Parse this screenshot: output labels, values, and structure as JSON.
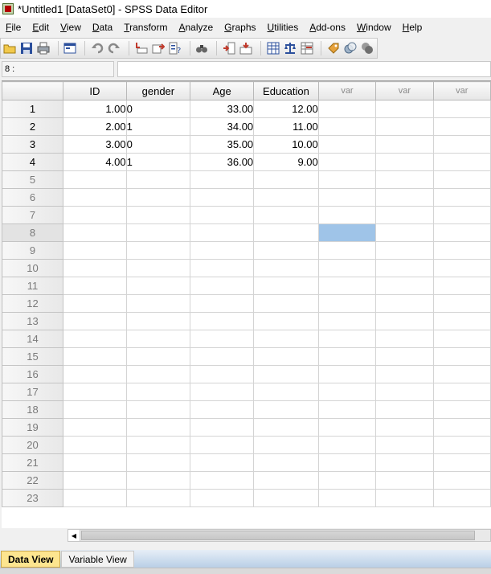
{
  "window": {
    "title": "*Untitled1 [DataSet0] - SPSS Data Editor"
  },
  "menu": [
    "File",
    "Edit",
    "View",
    "Data",
    "Transform",
    "Analyze",
    "Graphs",
    "Utilities",
    "Add-ons",
    "Window",
    "Help"
  ],
  "toolbar": {
    "icons": [
      "open-icon",
      "save-icon",
      "print-icon",
      "dialog-recall-icon",
      "undo-icon",
      "redo-icon",
      "goto-case-icon",
      "goto-variable-icon",
      "variables-icon",
      "find-icon",
      "insert-cases-icon",
      "insert-variable-icon",
      "split-file-icon",
      "weight-cases-icon",
      "select-cases-icon",
      "value-labels-icon",
      "use-sets-icon",
      "show-all-variables-icon"
    ]
  },
  "cell_editor": {
    "reference": "8 :",
    "value": ""
  },
  "grid": {
    "columns": [
      "ID",
      "gender",
      "Age",
      "Education",
      "var",
      "var",
      "var"
    ],
    "rows": [
      {
        "num": "1",
        "cells": [
          "1.00",
          "0",
          "33.00",
          "12.00",
          "",
          "",
          ""
        ]
      },
      {
        "num": "2",
        "cells": [
          "2.00",
          "1",
          "34.00",
          "11.00",
          "",
          "",
          ""
        ]
      },
      {
        "num": "3",
        "cells": [
          "3.00",
          "0",
          "35.00",
          "10.00",
          "",
          "",
          ""
        ]
      },
      {
        "num": "4",
        "cells": [
          "4.00",
          "1",
          "36.00",
          "9.00",
          "",
          "",
          ""
        ]
      },
      {
        "num": "5",
        "cells": [
          "",
          "",
          "",
          "",
          "",
          "",
          ""
        ]
      },
      {
        "num": "6",
        "cells": [
          "",
          "",
          "",
          "",
          "",
          "",
          ""
        ]
      },
      {
        "num": "7",
        "cells": [
          "",
          "",
          "",
          "",
          "",
          "",
          ""
        ]
      },
      {
        "num": "8",
        "cells": [
          "",
          "",
          "",
          "",
          "",
          "",
          ""
        ]
      },
      {
        "num": "9",
        "cells": [
          "",
          "",
          "",
          "",
          "",
          "",
          ""
        ]
      },
      {
        "num": "10",
        "cells": [
          "",
          "",
          "",
          "",
          "",
          "",
          ""
        ]
      },
      {
        "num": "11",
        "cells": [
          "",
          "",
          "",
          "",
          "",
          "",
          ""
        ]
      },
      {
        "num": "12",
        "cells": [
          "",
          "",
          "",
          "",
          "",
          "",
          ""
        ]
      },
      {
        "num": "13",
        "cells": [
          "",
          "",
          "",
          "",
          "",
          "",
          ""
        ]
      },
      {
        "num": "14",
        "cells": [
          "",
          "",
          "",
          "",
          "",
          "",
          ""
        ]
      },
      {
        "num": "15",
        "cells": [
          "",
          "",
          "",
          "",
          "",
          "",
          ""
        ]
      },
      {
        "num": "16",
        "cells": [
          "",
          "",
          "",
          "",
          "",
          "",
          ""
        ]
      },
      {
        "num": "17",
        "cells": [
          "",
          "",
          "",
          "",
          "",
          "",
          ""
        ]
      },
      {
        "num": "18",
        "cells": [
          "",
          "",
          "",
          "",
          "",
          "",
          ""
        ]
      },
      {
        "num": "19",
        "cells": [
          "",
          "",
          "",
          "",
          "",
          "",
          ""
        ]
      },
      {
        "num": "20",
        "cells": [
          "",
          "",
          "",
          "",
          "",
          "",
          ""
        ]
      },
      {
        "num": "21",
        "cells": [
          "",
          "",
          "",
          "",
          "",
          "",
          ""
        ]
      },
      {
        "num": "22",
        "cells": [
          "",
          "",
          "",
          "",
          "",
          "",
          ""
        ]
      },
      {
        "num": "23",
        "cells": [
          "",
          "",
          "",
          "",
          "",
          "",
          ""
        ]
      }
    ],
    "selected_cell": {
      "row": "8",
      "column": "var"
    },
    "selection_color": "#9fc4e8"
  },
  "tabs": {
    "data_view": "Data View",
    "variable_view": "Variable View",
    "active": "Data View"
  }
}
